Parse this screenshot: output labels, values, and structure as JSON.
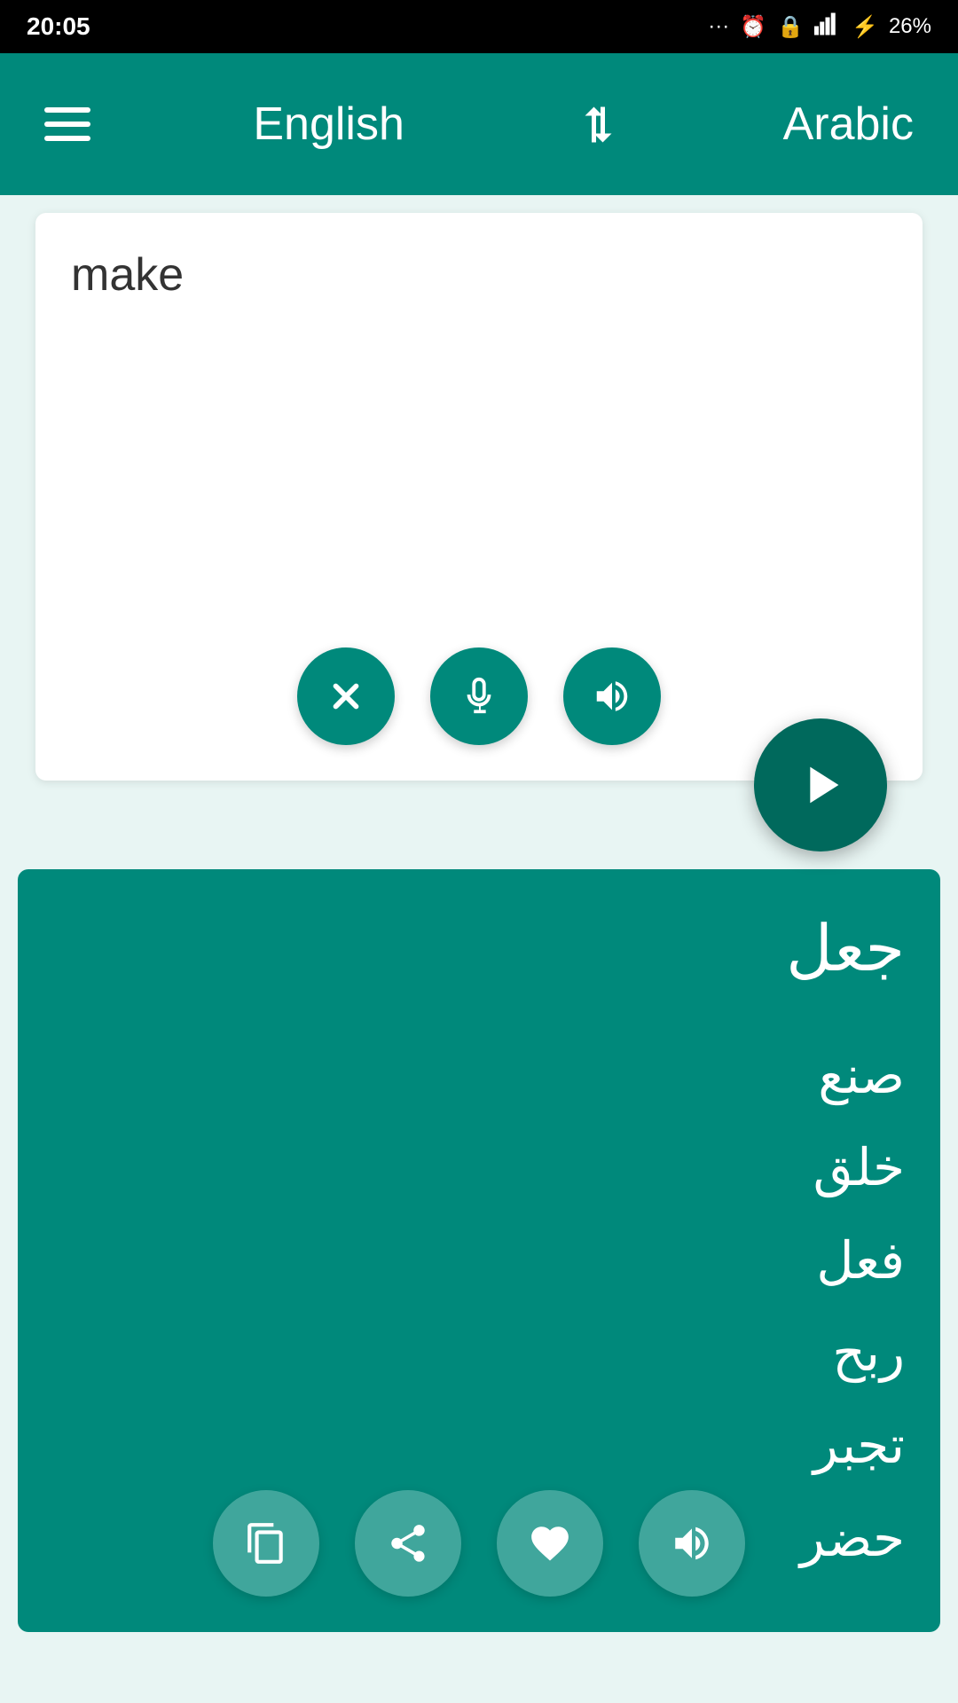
{
  "statusBar": {
    "time": "20:05",
    "icons": "··· ⏰ 🔒 📶 ⚡ 26%"
  },
  "toolbar": {
    "menuIconLabel": "menu",
    "sourceLanguage": "English",
    "swapIconLabel": "swap languages",
    "targetLanguage": "Arabic"
  },
  "inputArea": {
    "placeholder": "",
    "currentText": "make",
    "clearButtonLabel": "clear",
    "micButtonLabel": "microphone",
    "speakButtonLabel": "speak"
  },
  "translateButton": {
    "label": "translate"
  },
  "outputArea": {
    "primaryTranslation": "جعل",
    "secondaryTranslations": "صنع\nخلق\nفعل\nربح\nتجبر\nحضر",
    "copyButtonLabel": "copy",
    "shareButtonLabel": "share",
    "favoriteButtonLabel": "favorite",
    "speakButtonLabel": "speak"
  },
  "colors": {
    "teal": "#00897b",
    "darkTeal": "#00695c",
    "white": "#ffffff"
  }
}
